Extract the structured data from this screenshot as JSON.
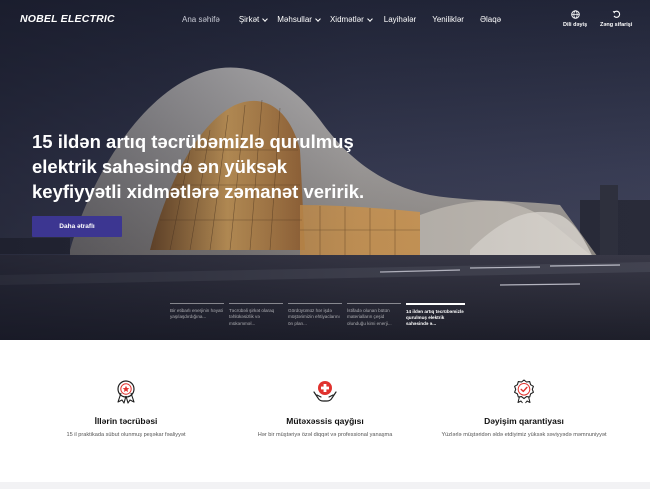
{
  "brand": {
    "logo_text": "NOBEL ELECTRIC"
  },
  "nav": {
    "items": [
      {
        "label": "Ana səhifə",
        "has_dropdown": false,
        "active": true
      },
      {
        "label": "Şirkət",
        "has_dropdown": true,
        "active": false
      },
      {
        "label": "Məhsullar",
        "has_dropdown": true,
        "active": false
      },
      {
        "label": "Xidmətlər",
        "has_dropdown": true,
        "active": false
      },
      {
        "label": "Layihələr",
        "has_dropdown": false,
        "active": false
      },
      {
        "label": "Yeniliklər",
        "has_dropdown": false,
        "active": false
      },
      {
        "label": "Əlaqə",
        "has_dropdown": false,
        "active": false
      }
    ],
    "language": {
      "label": "Dili dəyiş",
      "icon": "globe-icon"
    },
    "callback": {
      "label": "Zəng sifarişi",
      "icon": "phone-return-icon"
    }
  },
  "hero": {
    "headline_lines": [
      "15 ildən artıq təcrübəmizlə qurulmuş",
      "elektrik sahəsində ən yüksək",
      "keyfiyyətli xidmətlərə zəmanət veririk."
    ],
    "cta_label": "Daha ətraflı",
    "slides": [
      {
        "text": "Bir etibarlı enerjinin həyati yaşılaşdırdığına...",
        "active": false
      },
      {
        "text": "Təcrübəli şirkət olaraq təhlükəsizlik və mükəmməl...",
        "active": false
      },
      {
        "text": "Gördüyümüz hər işdə müştərimizin ehtiyaclarını ön plan...",
        "active": false
      },
      {
        "text": "İstifadə olunan bütün materialların çeşid olunduğu kimi enerji...",
        "active": false
      },
      {
        "text": "14 ildən artıq təcrübəmizlə qurulmuş elektrik sahəsində ə...",
        "active": true
      }
    ]
  },
  "features": [
    {
      "icon": "medal-icon",
      "title": "İllərin təcrübəsi",
      "description": "15 il praktikada sübut olunmuş peşəkar fəaliyyət",
      "color": "#1f1f1f"
    },
    {
      "icon": "medical-care-icon",
      "title": "Mütəxəssis qayğısı",
      "description": "Hər bir müştəriyə özəl diqqət və professional yanaşma",
      "color": "#e0322e"
    },
    {
      "icon": "quality-badge-icon",
      "title": "Dəyişim qarantiyası",
      "description": "Yüzlərlə müştəridən əldə etdiyimiz yüksək səviyyədə məmnuniyyət",
      "color": "#e0322e"
    }
  ],
  "colors": {
    "accent": "#3c3691",
    "hero_overlay": "#262b40",
    "icon_red": "#e0322e"
  }
}
